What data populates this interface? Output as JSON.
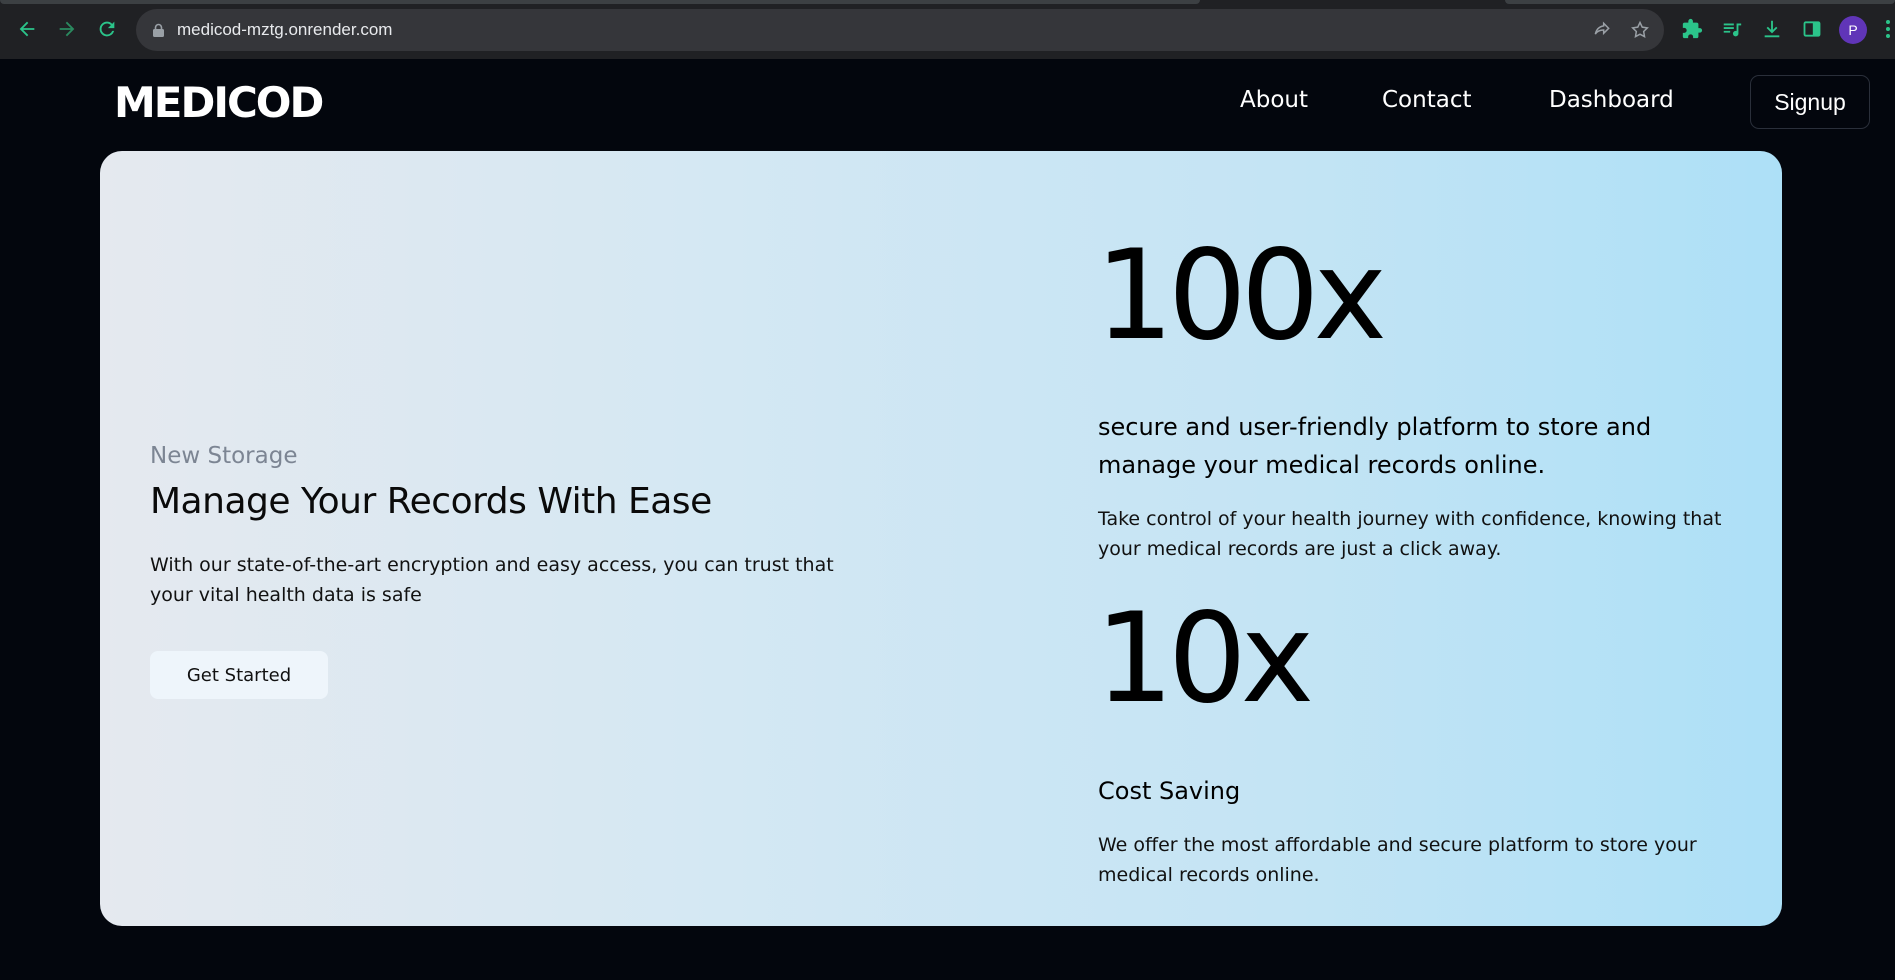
{
  "browser": {
    "url": "medicod-mztg.onrender.com",
    "profile_initial": "P",
    "accent_color": "#2bc48a"
  },
  "site": {
    "logo": "MEDICOD",
    "nav": {
      "about": "About",
      "contact": "Contact",
      "dashboard": "Dashboard",
      "signup": "Signup"
    }
  },
  "hero": {
    "eyebrow": "New Storage",
    "headline": "Manage Your Records With Ease",
    "lead": "With our state-of-the-art encryption and easy access, you can trust that your vital health data is safe",
    "cta_label": "Get Started",
    "stats": [
      {
        "value": "100x",
        "title": "secure and user-friendly platform to store and manage your medical records online.",
        "description": "Take control of your health journey with confidence, knowing that your medical records are just a click away."
      },
      {
        "value": "10x",
        "title": "Cost Saving",
        "description": "We offer the most affordable and secure platform to store your medical records online."
      }
    ]
  }
}
